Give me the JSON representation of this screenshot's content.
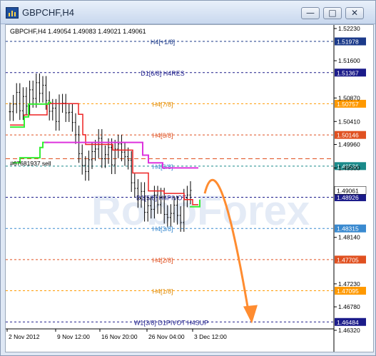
{
  "window": {
    "title": "GBPCHF,H4",
    "buttons": {
      "minimize": "—",
      "maximize": "□",
      "close": "✕"
    }
  },
  "chart": {
    "info_label": "GBPCHF,H4  1.49054 1.49083 1.49021 1.49061",
    "watermark": "RoboForex",
    "order_label": "#67681937 sell",
    "colors": {
      "grid_blue": "#1b1b8a",
      "grid_orange": "#ff9900",
      "grid_red": "#e05020",
      "grid_darkgreen": "#1a6a5a",
      "line_green": "#33ee33",
      "line_magenta": "#dd33dd",
      "line_red": "#ee2222",
      "arrow": "#ff8c30"
    }
  },
  "levels": [
    {
      "name": "H4[+1/8]",
      "price": "1.51978",
      "color": "#1b3a8a",
      "name_color": "#1b3a8a"
    },
    {
      "name": "D1[6/8] H4RES",
      "price": "1.51367",
      "color": "#1b1b8a",
      "name_color": "#1b1b8a"
    },
    {
      "name": "H4[7/8]",
      "price": "1.50757",
      "color": "#ff9900",
      "name_color": "#e08a00"
    },
    {
      "name": "H4[6/8]",
      "price": "1.50146",
      "color": "#e05020",
      "name_color": "#e05020"
    },
    {
      "name": "H4[5/8]",
      "price": "1.49536",
      "color": "#1a8a8a",
      "name_color": "#3a8ad0"
    },
    {
      "name": "D1[5/8] H4PIVOT",
      "price": "1.48926",
      "color": "#1b1b8a",
      "name_color": "#1b1b8a"
    },
    {
      "name": "H4[3/8]",
      "price": "1.48315",
      "color": "#3a8ad0",
      "name_color": "#3a8ad0"
    },
    {
      "name": "H4[2/8]",
      "price": "1.47705",
      "color": "#e05020",
      "name_color": "#e05020"
    },
    {
      "name": "H4[1/8]",
      "price": "1.47095",
      "color": "#ff9900",
      "name_color": "#e08a00"
    },
    {
      "name": "W1[3/8] D1PIVOT H4SUP",
      "price": "1.46484",
      "color": "#1b1b8a",
      "name_color": "#1b1b8a"
    }
  ],
  "price_axis": {
    "ticks": [
      "1.52230",
      "1.51600",
      "1.50870",
      "1.50410",
      "1.49960",
      "1.49500",
      "1.48140",
      "1.47230",
      "1.46780",
      "1.46320"
    ],
    "current_price": "1.49061"
  },
  "time_axis": {
    "labels": [
      "2 Nov 2012",
      "9 Nov 12:00",
      "16 Nov 20:00",
      "26 Nov 04:00",
      "3 Dec 12:00"
    ]
  },
  "price_series": {
    "closes": [
      1.506,
      1.5075,
      1.5098,
      1.5062,
      1.509,
      1.5071,
      1.5103,
      1.5086,
      1.5117,
      1.5096,
      1.5112,
      1.5082,
      1.5061,
      1.5067,
      1.5041,
      1.5076,
      1.5077,
      1.5058,
      1.5059,
      1.5039,
      1.5015,
      1.4978,
      1.4955,
      1.4943,
      1.4966,
      1.4982,
      1.4987,
      1.5008,
      1.4968,
      1.4976,
      1.499,
      1.4956,
      1.4987,
      1.4997,
      1.4981,
      1.4972,
      1.4965,
      1.4921,
      1.491,
      1.489,
      1.4904,
      1.4863,
      1.4876,
      1.4869,
      1.4897,
      1.4878,
      1.4893,
      1.4859,
      1.4853,
      1.4861,
      1.4877,
      1.4857,
      1.4843,
      1.4891,
      1.4897,
      1.4906
    ],
    "forecast_target": 1.4648
  }
}
